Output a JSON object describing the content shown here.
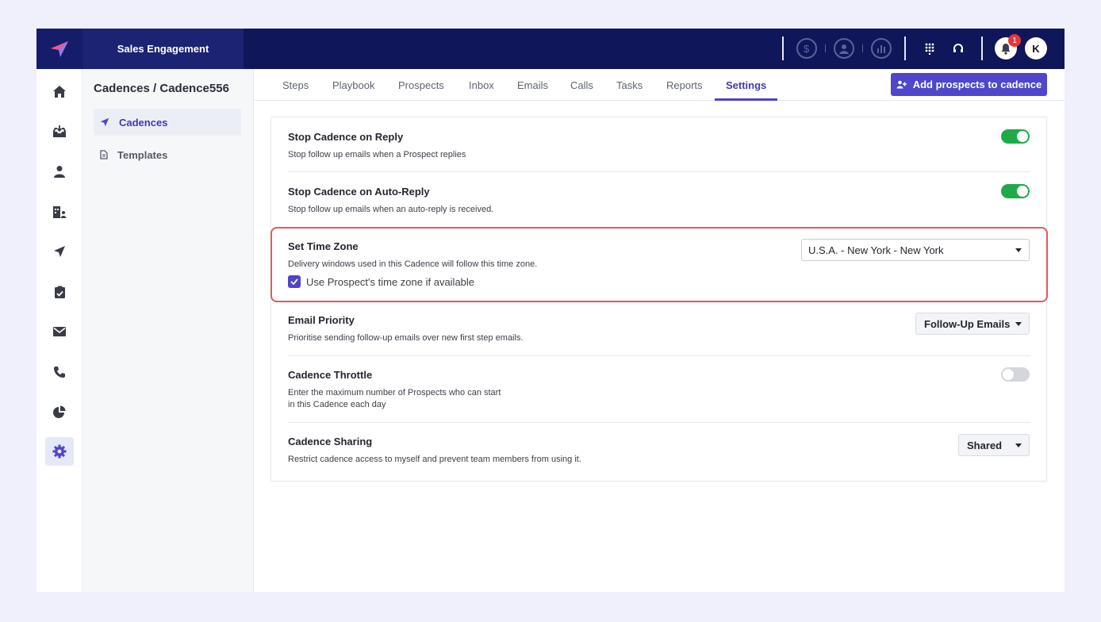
{
  "app": {
    "product_name": "Sales Engagement",
    "notification_count": "1",
    "user_initial": "K",
    "accent_color": "#4f45c6",
    "topbar_color": "#10165a"
  },
  "topbar_icons": [
    "dollar-icon",
    "user-circle-icon",
    "chart-icon",
    "dialpad-icon",
    "headset-icon",
    "bell-icon"
  ],
  "rail": {
    "items": [
      "home-icon",
      "inbox-icon",
      "person-icon",
      "contacts-icon",
      "send-icon",
      "clipboard-icon",
      "mail-icon",
      "phone-icon",
      "pie-chart-icon",
      "settings-icon"
    ],
    "active": "settings-icon"
  },
  "subnav": {
    "breadcrumb": "Cadences / Cadence556",
    "items": [
      {
        "label": "Cadences",
        "active": true
      },
      {
        "label": "Templates",
        "active": false
      }
    ]
  },
  "tabs": {
    "items": [
      "Steps",
      "Playbook",
      "Prospects",
      "Inbox",
      "Emails",
      "Calls",
      "Tasks",
      "Reports",
      "Settings"
    ],
    "active": "Settings"
  },
  "actions": {
    "add_prospects": "Add prospects to cadence"
  },
  "settings": {
    "stop_on_reply": {
      "title": "Stop Cadence on Reply",
      "description": "Stop follow up emails when a Prospect replies",
      "enabled": true
    },
    "stop_on_auto_reply": {
      "title": "Stop Cadence on Auto-Reply",
      "description": "Stop follow up emails when an auto-reply is received.",
      "enabled": true
    },
    "time_zone": {
      "title": "Set Time Zone",
      "description": "Delivery windows used in this Cadence will follow this time zone.",
      "value": "U.S.A. - New York - New York",
      "use_prospect_tz_label": "Use Prospect's time zone if available",
      "use_prospect_tz_checked": true
    },
    "email_priority": {
      "title": "Email Priority",
      "description": "Prioritise sending follow-up emails over new first step emails.",
      "value": "Follow-Up Emails"
    },
    "throttle": {
      "title": "Cadence Throttle",
      "description_line1": "Enter the maximum number of Prospects who can start",
      "description_line2": "in this Cadence each day",
      "enabled": false
    },
    "sharing": {
      "title": "Cadence Sharing",
      "description": "Restrict cadence access to myself and prevent team members from using it.",
      "value": "Shared"
    }
  }
}
